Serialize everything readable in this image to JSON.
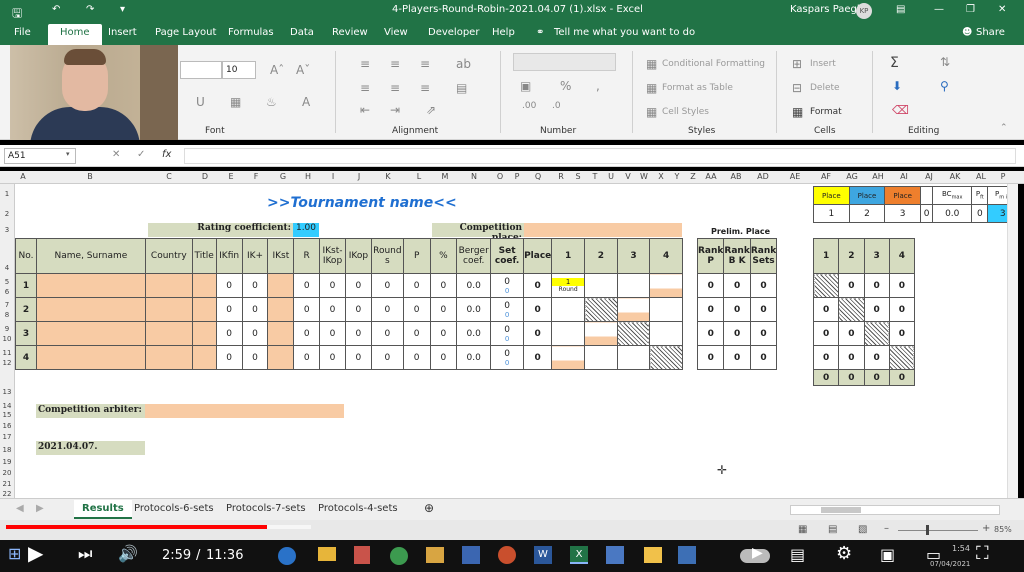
{
  "window": {
    "title": "4-Players-Round-Robin-2021.04.07 (1).xlsx  -  Excel",
    "user": "Kaspars Paegle",
    "user_initials": "KP"
  },
  "ribbon_tabs": [
    "File",
    "Home",
    "Insert",
    "Page Layout",
    "Formulas",
    "Data",
    "Review",
    "View",
    "Developer",
    "Help"
  ],
  "tell_me": "Tell me what you want to do",
  "share": "Share",
  "ribbon": {
    "font_size": "10",
    "groups": [
      "Font",
      "Alignment",
      "Number",
      "Styles",
      "Cells",
      "Editing"
    ],
    "styles": [
      "Conditional Formatting",
      "Format as Table",
      "Cell Styles"
    ],
    "cells": [
      "Insert",
      "Delete",
      "Format"
    ]
  },
  "name_box": "A51",
  "fx": "fx",
  "columns": [
    "A",
    "B",
    "C",
    "D",
    "E",
    "F",
    "G",
    "H",
    "I",
    "J",
    "K",
    "L",
    "M",
    "N",
    "O",
    "P",
    "Q",
    "R",
    "S",
    "T",
    "U",
    "V",
    "W",
    "X",
    "Y",
    "Z",
    "AA",
    "AB",
    "AD",
    "AE",
    "AF",
    "AG",
    "AH",
    "AI",
    "AJ",
    "AK",
    "AL",
    "P"
  ],
  "rows": [
    "1",
    "2",
    "3",
    "4",
    "5",
    "6",
    "7",
    "8",
    "9",
    "10",
    "11",
    "12",
    "13",
    "14",
    "15",
    "16",
    "17",
    "18",
    "19",
    "20",
    "21",
    "22"
  ],
  "sheet": {
    "title": ">>Tournament name<<",
    "rating_label": "Rating coefficient:",
    "rating_value": "1.00",
    "competition_place": "Competition place:",
    "prelim_place": "Prelim. Place",
    "headers": [
      "No.",
      "Name, Surname",
      "Country",
      "Title",
      "IKfin",
      "IK+",
      "IKst",
      "R",
      "IKst-IKop",
      "IKop",
      "Round s",
      "P",
      "%",
      "Berger coef.",
      "Set coef.",
      "Place",
      "1",
      "2",
      "3",
      "4"
    ],
    "rank_headers": [
      "Rank P",
      "Rank B K",
      "Rank Sets"
    ],
    "right_headers": [
      "1",
      "2",
      "3",
      "4"
    ],
    "rows": [
      {
        "no": "1",
        "vals": [
          "0",
          "0",
          "0",
          "0",
          "0",
          "0",
          "0",
          "0",
          "0.0",
          "0"
        ],
        "set_a": "0",
        "set_b": "0",
        "place": "0",
        "ranks": [
          "0",
          "0",
          "0"
        ]
      },
      {
        "no": "2",
        "vals": [
          "0",
          "0",
          "0",
          "0",
          "0",
          "0",
          "0",
          "0",
          "0.0",
          "0"
        ],
        "set_a": "0",
        "set_b": "0",
        "place": "0",
        "ranks": [
          "0",
          "0",
          "0"
        ]
      },
      {
        "no": "3",
        "vals": [
          "0",
          "0",
          "0",
          "0",
          "0",
          "0",
          "0",
          "0",
          "0.0",
          "0"
        ],
        "set_a": "0",
        "set_b": "0",
        "place": "0",
        "ranks": [
          "0",
          "0",
          "0"
        ]
      },
      {
        "no": "4",
        "vals": [
          "0",
          "0",
          "0",
          "0",
          "0",
          "0",
          "0",
          "0",
          "0.0",
          "0"
        ],
        "set_a": "0",
        "set_b": "0",
        "place": "0",
        "ranks": [
          "0",
          "0",
          "0"
        ]
      }
    ],
    "round_cell": {
      "num": "1",
      "label": "Round"
    },
    "right_grid": [
      [
        "",
        "0",
        "0",
        "0"
      ],
      [
        "0",
        "",
        "0",
        "0"
      ],
      [
        "0",
        "0",
        "",
        "0"
      ],
      [
        "0",
        "0",
        "0",
        ""
      ]
    ],
    "right_totals": [
      "0",
      "0",
      "0",
      "0"
    ],
    "legend": {
      "labels": [
        "Place",
        "Place",
        "Place",
        "",
        "BC",
        "P",
        "P"
      ],
      "sub": [
        "max",
        "ft",
        "m in"
      ],
      "values": [
        "1",
        "2",
        "3",
        "0",
        "0.0",
        "0",
        "3"
      ]
    },
    "arbiter_label": "Competition arbiter:",
    "date": "2021.04.07."
  },
  "sheet_tabs": [
    "Results",
    "Protocols-6-sets",
    "Protocols-7-sets",
    "Protocols-4-sets"
  ],
  "zoom": "85%",
  "video": {
    "current": "2:59",
    "duration": "11:36",
    "progress": 0.258,
    "clock": "1:54",
    "clock_date": "07/04/2021"
  }
}
